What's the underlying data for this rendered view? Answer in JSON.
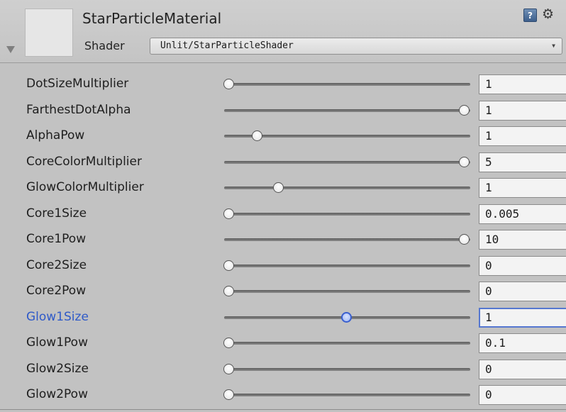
{
  "header": {
    "material_name": "StarParticleMaterial",
    "shader_label": "Shader",
    "shader_value": "Unlit/StarParticleShader",
    "icons": [
      "help-icon",
      "gear-icon",
      "fold-arrow-icon",
      "dropdown-caret-icon"
    ]
  },
  "properties": [
    {
      "label": "DotSizeMultiplier",
      "value": "1",
      "slider_fraction": 0.0,
      "active": false
    },
    {
      "label": "FarthestDotAlpha",
      "value": "1",
      "slider_fraction": 1.0,
      "active": false
    },
    {
      "label": "AlphaPow",
      "value": "1",
      "slider_fraction": 0.12,
      "active": false
    },
    {
      "label": "CoreColorMultiplier",
      "value": "5",
      "slider_fraction": 1.0,
      "active": false
    },
    {
      "label": "GlowColorMultiplier",
      "value": "1",
      "slider_fraction": 0.21,
      "active": false
    },
    {
      "label": "Core1Size",
      "value": "0.005",
      "slider_fraction": 0.0,
      "active": false
    },
    {
      "label": "Core1Pow",
      "value": "10",
      "slider_fraction": 1.0,
      "active": false
    },
    {
      "label": "Core2Size",
      "value": "0",
      "slider_fraction": 0.0,
      "active": false
    },
    {
      "label": "Core2Pow",
      "value": "0",
      "slider_fraction": 0.0,
      "active": false
    },
    {
      "label": "Glow1Size",
      "value": "1",
      "slider_fraction": 0.5,
      "active": true
    },
    {
      "label": "Glow1Pow",
      "value": "0.1",
      "slider_fraction": 0.0,
      "active": false
    },
    {
      "label": "Glow2Size",
      "value": "0",
      "slider_fraction": 0.0,
      "active": false
    },
    {
      "label": "Glow2Pow",
      "value": "0",
      "slider_fraction": 0.0,
      "active": false
    }
  ],
  "colors": {
    "background": "#c2c2c2",
    "active_label": "#2f5ac8",
    "active_thumb_border": "#3a5fcf"
  }
}
